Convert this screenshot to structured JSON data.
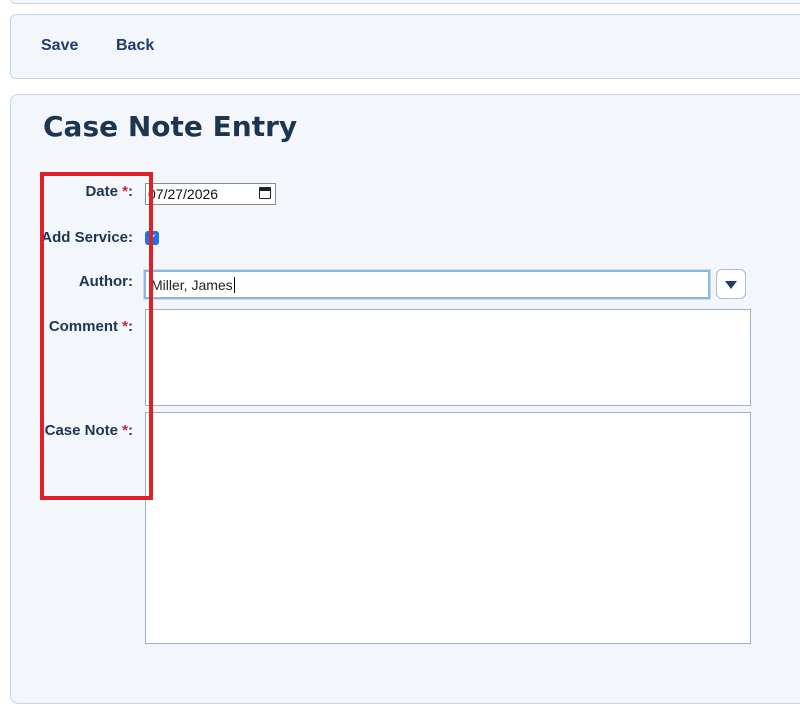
{
  "toolbar": {
    "save_label": "Save",
    "back_label": "Back"
  },
  "page": {
    "title": "Case Note Entry"
  },
  "form": {
    "date": {
      "label": "Date ",
      "required_mark": "*",
      "suffix": ":",
      "value": "07/27/2026"
    },
    "add_service": {
      "label": "Add Service:",
      "checked": true
    },
    "author": {
      "label": "Author:",
      "value": "Miller, James"
    },
    "comment": {
      "label": "Comment ",
      "required_mark": "*",
      "suffix": ":",
      "value": ""
    },
    "case_note": {
      "label": "Case Note ",
      "required_mark": "*",
      "suffix": ":",
      "value": ""
    }
  },
  "colors": {
    "accent": "#1e3d6e",
    "required": "#d0203a",
    "highlight": "#e01f26",
    "checkbox": "#1a73e8"
  },
  "icons": {
    "calendar": "calendar-icon",
    "dropdown": "chevron-down-icon",
    "check": "check-icon"
  }
}
